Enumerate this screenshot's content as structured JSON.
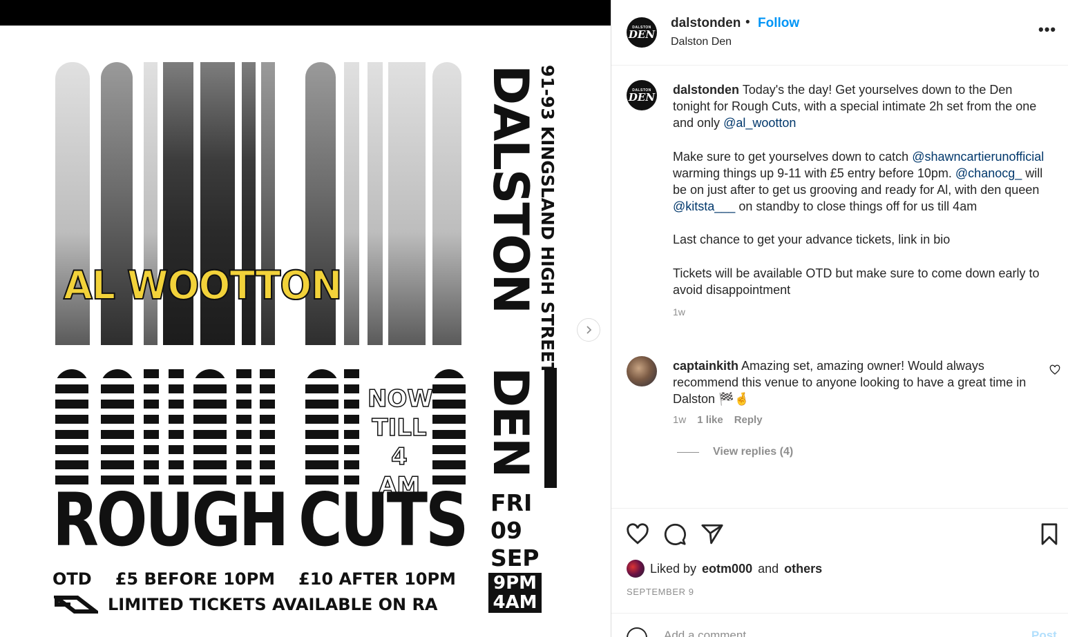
{
  "poster": {
    "artist": "AL WOOTTON",
    "now_till": [
      "NOW",
      "TILL",
      "4 AM"
    ],
    "title_left": "ROUGH",
    "title_right": "CUTS",
    "otd": "OTD",
    "price_before": "£5 BEFORE 10PM",
    "price_after": "£10 AFTER 10PM",
    "tickets": "LIMITED TICKETS AVAILABLE ON RA",
    "address": "91-93 KINGSLAND HIGH STREET",
    "venue_top": "DALSTON",
    "venue_bottom": "DEN",
    "day": "FRI",
    "date_num": "09",
    "month": "SEP",
    "time_start": "9PM",
    "time_end": "4AM"
  },
  "header": {
    "avatar_small": "DALSTON",
    "avatar_big": "DEN",
    "username": "dalstonden",
    "separator": "•",
    "follow": "Follow",
    "subtitle": "Dalston Den",
    "more": "•••"
  },
  "caption": {
    "username": "dalstonden",
    "p1_text": "Today's the day! Get yourselves down to the Den tonight for Rough Cuts, with a special intimate 2h set from the one and only",
    "p1_mention": "@al_wootton",
    "p2_a": "Make sure to get yourselves down to catch",
    "p2_mention1": "@shawncartierunofficial",
    "p2_b": "warming things up 9-11 with £5 entry before 10pm.",
    "p2_mention2": "@chanocg_",
    "p2_c": "will be on just after to get us grooving and ready for Al, with den queen",
    "p2_mention3": "@kitsta___",
    "p2_d": "on standby to close things off for us till 4am",
    "p3": "Last chance to get your advance tickets, link in bio",
    "p4": "Tickets will be available OTD but make sure to come down early to avoid disappointment",
    "time": "1w"
  },
  "comment": {
    "username": "captainkith",
    "text": "Amazing set, amazing owner! Would always recommend this venue to anyone looking to have a great time in Dalston 🏁🤞",
    "time": "1w",
    "likes": "1 like",
    "reply": "Reply",
    "view_replies": "View replies (4)"
  },
  "actions": {
    "liked_prefix": "Liked by",
    "liked_user": "eotm000",
    "liked_and": "and",
    "liked_others": "others",
    "date": "SEPTEMBER 9"
  },
  "add_comment": {
    "placeholder": "Add a comment...",
    "post": "Post"
  }
}
